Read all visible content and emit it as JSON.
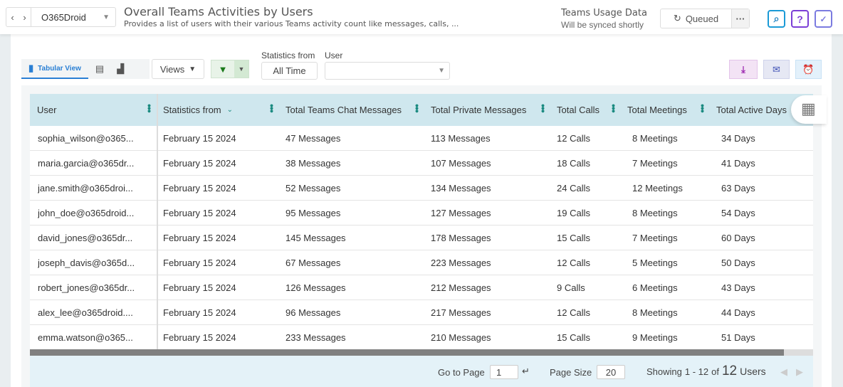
{
  "header": {
    "workspace": "O365Droid",
    "title": "Overall Teams Activities by Users",
    "subtitle": "Provides a list of users with their various Teams activity count like messages, calls, ...",
    "sync_title": "Teams Usage Data",
    "sync_status": "Will be synced shortly",
    "queued_label": "Queued",
    "more_label": "···",
    "help_label": "?"
  },
  "toolbar": {
    "tabular_view": "Tabular View",
    "views_label": "Views",
    "stats_from_label": "Statistics from",
    "stats_from_value": "All Time",
    "user_label": "User",
    "user_value": ""
  },
  "table": {
    "columns": [
      "User",
      "Statistics from",
      "Total Teams Chat Messages",
      "Total Private Messages",
      "Total Calls",
      "Total Meetings",
      "Total Active Days"
    ],
    "rows": [
      [
        "sophia_wilson@o365...",
        "February 15 2024",
        "47 Messages",
        "113 Messages",
        "12 Calls",
        "8 Meetings",
        "34 Days"
      ],
      [
        "maria.garcia@o365dr...",
        "February 15 2024",
        "38 Messages",
        "107 Messages",
        "18 Calls",
        "7 Meetings",
        "41 Days"
      ],
      [
        "jane.smith@o365droi...",
        "February 15 2024",
        "52 Messages",
        "134 Messages",
        "24 Calls",
        "12 Meetings",
        "63 Days"
      ],
      [
        "john_doe@o365droid...",
        "February 15 2024",
        "95 Messages",
        "127 Messages",
        "19 Calls",
        "8 Meetings",
        "54 Days"
      ],
      [
        "david_jones@o365dr...",
        "February 15 2024",
        "145 Messages",
        "178 Messages",
        "15 Calls",
        "7 Meetings",
        "60 Days"
      ],
      [
        "joseph_davis@o365d...",
        "February 15 2024",
        "67 Messages",
        "223 Messages",
        "12 Calls",
        "5 Meetings",
        "50 Days"
      ],
      [
        "robert_jones@o365dr...",
        "February 15 2024",
        "126 Messages",
        "212 Messages",
        "9 Calls",
        "6 Meetings",
        "43 Days"
      ],
      [
        "alex_lee@o365droid....",
        "February 15 2024",
        "96 Messages",
        "217 Messages",
        "12 Calls",
        "8 Meetings",
        "44 Days"
      ],
      [
        "emma.watson@o365...",
        "February 15 2024",
        "233 Messages",
        "210 Messages",
        "15 Calls",
        "9 Meetings",
        "51 Days"
      ]
    ]
  },
  "footer": {
    "go_to_page_label": "Go to Page",
    "page": "1",
    "page_size_label": "Page Size",
    "page_size": "20",
    "showing_prefix": "Showing",
    "range": "1 - 12",
    "of": "of",
    "total": "12",
    "unit": "Users"
  }
}
